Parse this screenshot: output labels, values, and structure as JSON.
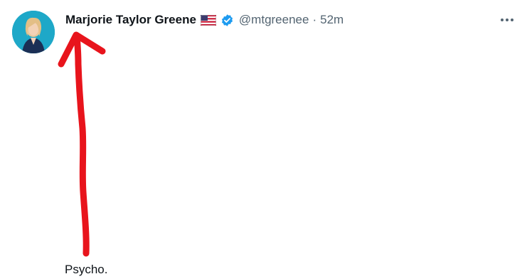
{
  "tweet": {
    "display_name": "Marjorie Taylor Greene",
    "handle": "@mtgreenee",
    "separator": "·",
    "timestamp": "52m",
    "text": "Psycho."
  },
  "icons": {
    "flag": "us-flag-icon",
    "verified": "verified-badge-icon",
    "more": "more-options-icon",
    "annotation": "red-arrow-annotation"
  },
  "colors": {
    "name": "#0f1419",
    "secondary": "#536471",
    "verified": "#1d9bf0",
    "annotation": "#e8141c"
  }
}
